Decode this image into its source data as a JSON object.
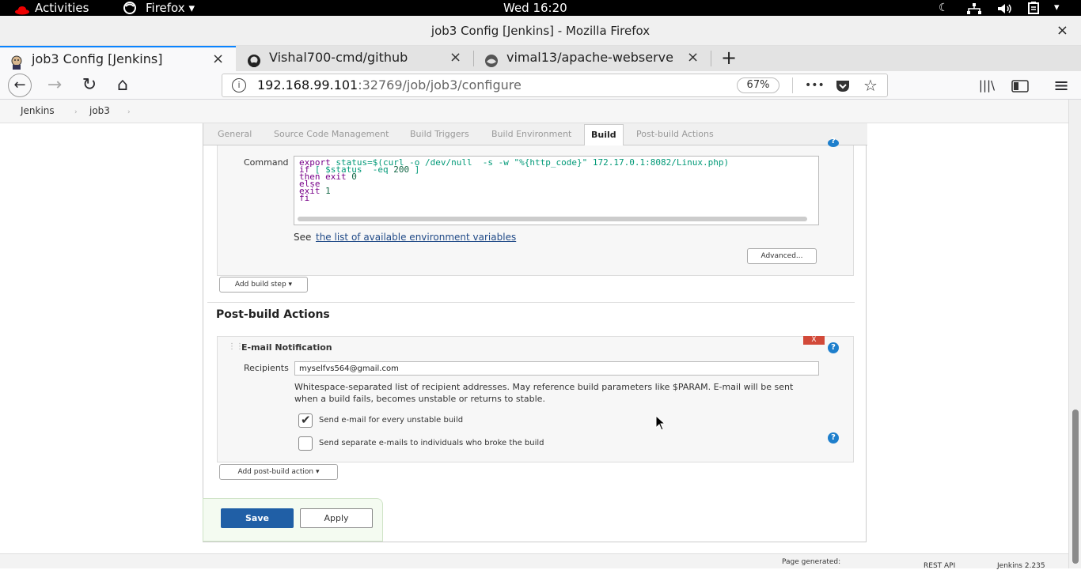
{
  "system_bar": {
    "activities": "Activities",
    "app_menu": "Firefox",
    "clock": "Wed 16:20"
  },
  "window": {
    "title": "job3 Config [Jenkins] - Mozilla Firefox",
    "close": "×"
  },
  "tabs": [
    {
      "label": "job3 Config [Jenkins]",
      "active": true
    },
    {
      "label": "Vishal700-cmd/github",
      "active": false
    },
    {
      "label": "vimal13/apache-webserve",
      "active": false
    }
  ],
  "tab_close_glyph": "×",
  "new_tab_glyph": "+",
  "navigation": {
    "back": "←",
    "forward": "→",
    "reload": "↻",
    "home": "⌂",
    "url_host": "192.168.99.101",
    "url_rest": ":32769/job/job3/configure",
    "zoom": "67%",
    "more": "•••",
    "library": "|||\\",
    "sidebar": "▭",
    "menu": "≡"
  },
  "breadcrumb": {
    "items": [
      "Jenkins",
      "job3"
    ],
    "separator": "›"
  },
  "config_tabs": [
    "General",
    "Source Code Management",
    "Build Triggers",
    "Build Environment",
    "Build",
    "Post-build Actions"
  ],
  "active_config_tab": "Build",
  "build_step": {
    "command_label": "Command",
    "command_lines": [
      "export status=$(curl -o /dev/null  -s -w \"%{http_code}\" 172.17.0.1:8082/Linux.php)",
      "if [ $status  -eq 200 ]",
      "then exit 0",
      "else",
      "exit 1",
      "fi"
    ],
    "see_text": "See",
    "env_link": "the list of available environment variables",
    "advanced_button": "Advanced...",
    "add_build_step": "Add build step"
  },
  "post_build": {
    "heading": "Post-build Actions",
    "email_title": "E-mail Notification",
    "delete_glyph": "X",
    "recipients_label": "Recipients",
    "recipients_value": "myselfvs564@gmail.com",
    "help_text": "Whitespace-separated list of recipient addresses. May reference build parameters like $PARAM. E-mail will be sent when a build fails, becomes unstable or returns to stable.",
    "checkbox_unstable": {
      "label": "Send e-mail for every unstable build",
      "checked": true
    },
    "checkbox_individuals": {
      "label": "Send separate e-mails to individuals who broke the build",
      "checked": false
    },
    "add_post_build": "Add post-build action"
  },
  "actions": {
    "save": "Save",
    "apply": "Apply"
  },
  "footer": {
    "page_generated": "Page generated:",
    "rest_api": "REST API",
    "version": "Jenkins 2.235"
  },
  "help_glyph": "?",
  "dropdown_glyph": "▾",
  "colors": {
    "save_blue": "#205fa6",
    "help_blue": "#1e7fcc",
    "delete_red": "#d24939",
    "link_blue": "#204a87",
    "tab_accent": "#0a84ff"
  }
}
